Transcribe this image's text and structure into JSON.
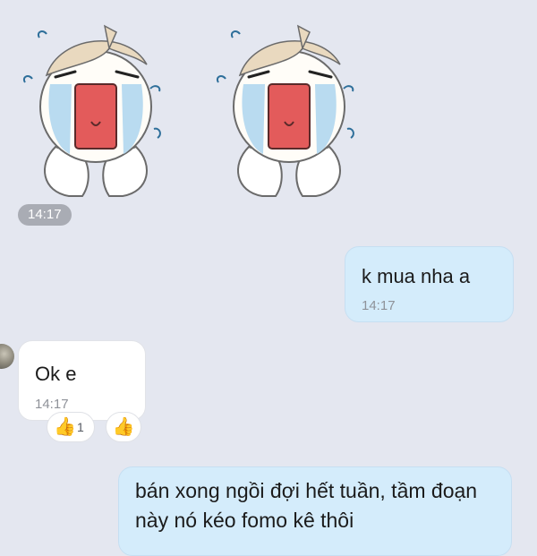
{
  "stickers": [
    {
      "icon": "crying-face-sticker"
    },
    {
      "icon": "crying-face-sticker"
    }
  ],
  "sticker_time": "14:17",
  "messages": [
    {
      "direction": "out",
      "text": "k mua nha a",
      "time": "14:17"
    },
    {
      "direction": "in",
      "text": "Ok e",
      "time": "14:17"
    },
    {
      "direction": "out",
      "text": "bán xong ngồi đợi hết tuần, tầm đoạn này nó kéo fomo kê thôi"
    }
  ],
  "reactions": [
    {
      "icon": "thumbs-up-icon",
      "glyph": "👍",
      "count": "1"
    },
    {
      "icon": "add-reaction-thumbs-up-icon",
      "glyph": "👍"
    }
  ],
  "colors": {
    "background": "#e4e7f0",
    "outgoing_bubble": "#d4ecfb",
    "incoming_bubble": "#ffffff",
    "time_chip": "#a9acb4"
  }
}
